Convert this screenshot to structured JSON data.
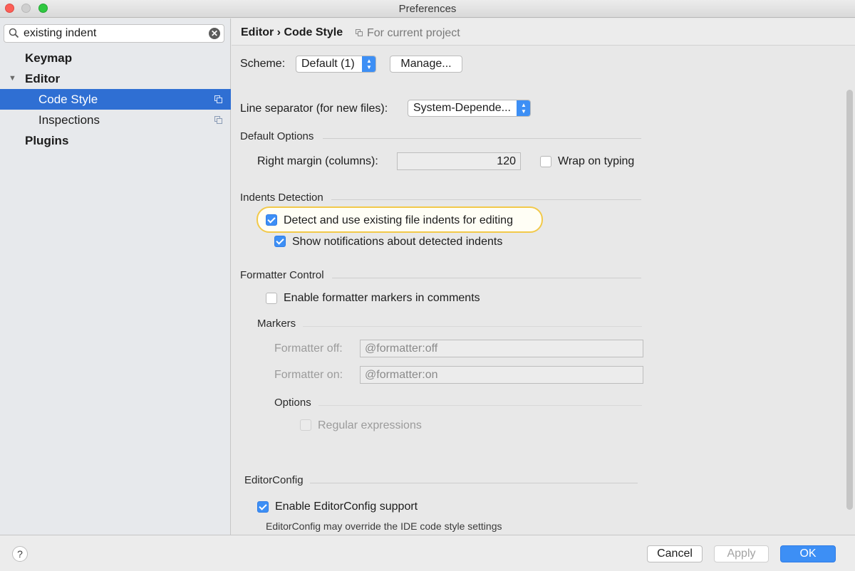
{
  "window": {
    "title": "Preferences"
  },
  "sidebar": {
    "search": {
      "value": "existing indent",
      "placeholder": ""
    },
    "items": [
      {
        "label": "Keymap"
      },
      {
        "label": "Editor"
      },
      {
        "label": "Code Style"
      },
      {
        "label": "Inspections"
      },
      {
        "label": "Plugins"
      }
    ]
  },
  "header": {
    "breadcrumb": "Editor › Code Style",
    "scope": "For current project"
  },
  "scheme": {
    "label": "Scheme:",
    "value": "Default (1)",
    "manage_button": "Manage..."
  },
  "line_separator": {
    "label": "Line separator (for new files):",
    "value": "System-Depende..."
  },
  "default_options": {
    "title": "Default Options",
    "right_margin_label": "Right margin (columns):",
    "right_margin_value": "120",
    "wrap_on_typing": {
      "label": "Wrap on typing",
      "checked": false
    }
  },
  "indents_detection": {
    "title": "Indents Detection",
    "detect": {
      "label": "Detect and use existing file indents for editing",
      "checked": true
    },
    "notify": {
      "label": "Show notifications about detected indents",
      "checked": true
    }
  },
  "formatter_control": {
    "title": "Formatter Control",
    "enable": {
      "label": "Enable formatter markers in comments",
      "checked": false
    },
    "markers_title": "Markers",
    "off_label": "Formatter off:",
    "off_value": "@formatter:off",
    "on_label": "Formatter on:",
    "on_value": "@formatter:on",
    "options_title": "Options",
    "regex": {
      "label": "Regular expressions",
      "checked": false
    }
  },
  "editorconfig": {
    "title": "EditorConfig",
    "enable": {
      "label": "Enable EditorConfig support",
      "checked": true
    },
    "note": "EditorConfig may override the IDE code style settings"
  },
  "footer": {
    "help": "?",
    "cancel": "Cancel",
    "apply": "Apply",
    "ok": "OK"
  },
  "colors": {
    "accent": "#3d8ff5",
    "selection": "#2f6fd3",
    "focus_ring": "#f2c94a"
  }
}
